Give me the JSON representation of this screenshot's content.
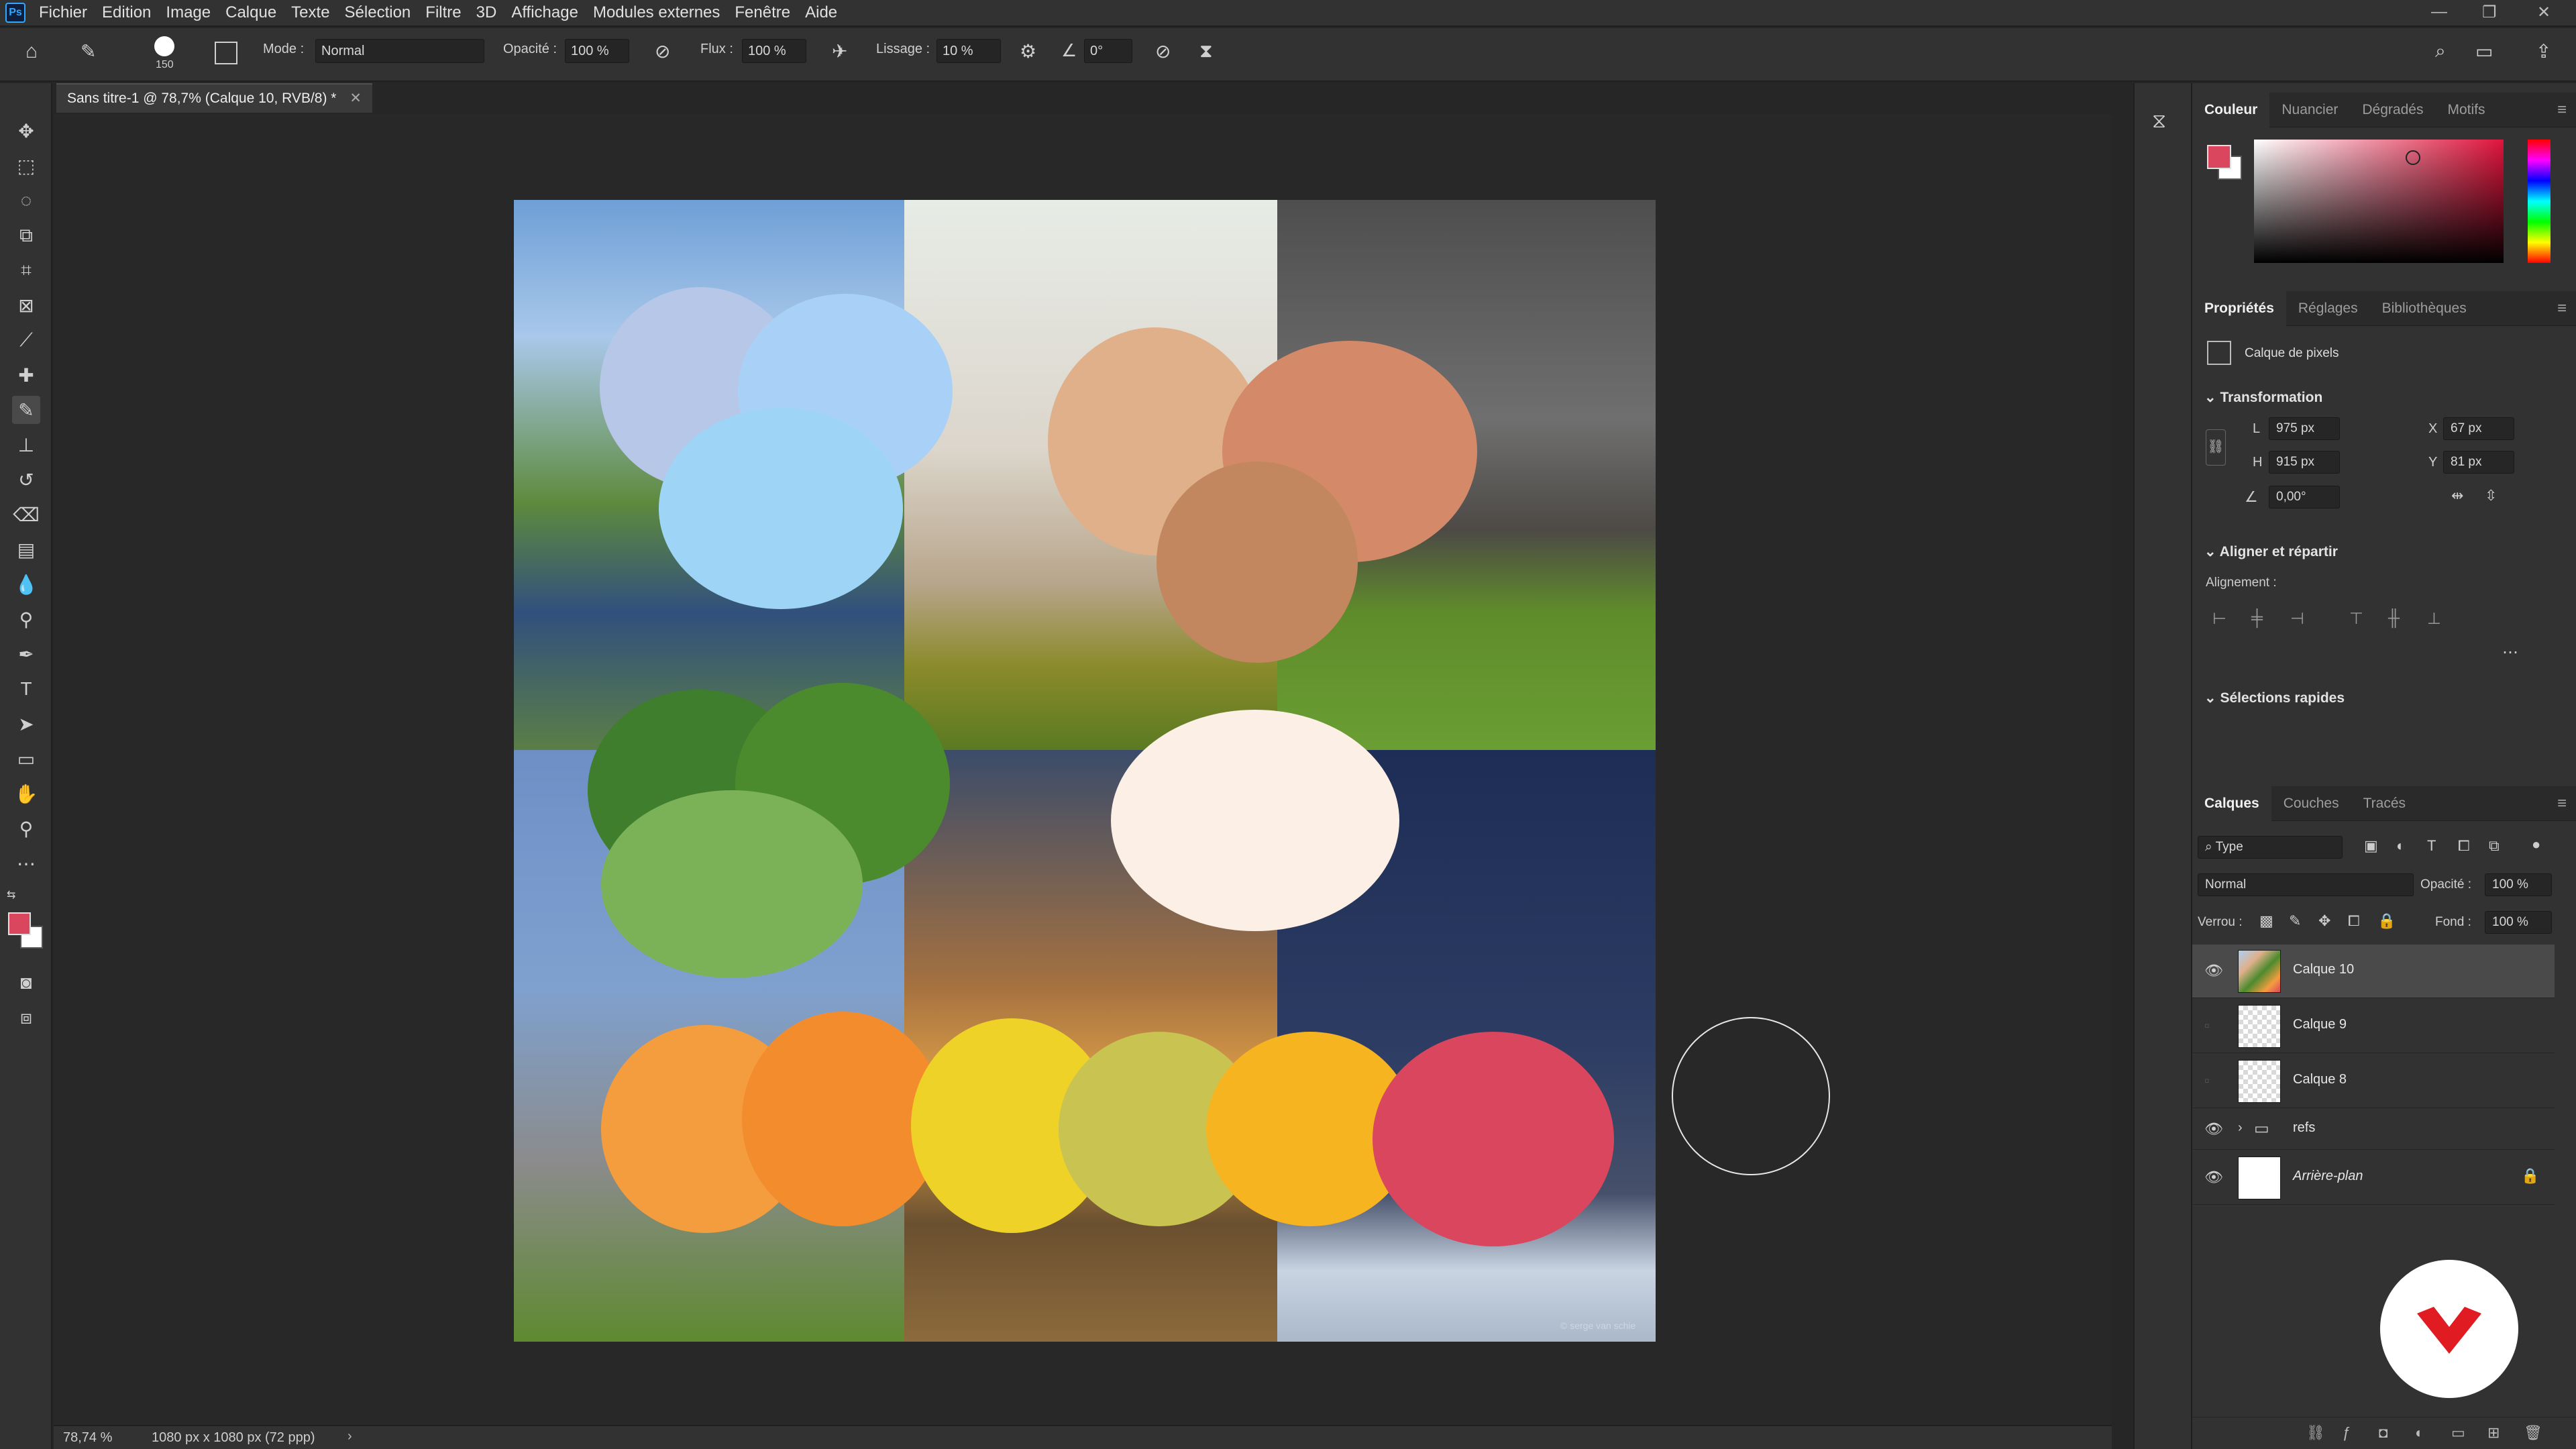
{
  "app": {
    "logo_text": "Ps"
  },
  "menu": [
    "Fichier",
    "Edition",
    "Image",
    "Calque",
    "Texte",
    "Sélection",
    "Filtre",
    "3D",
    "Affichage",
    "Modules externes",
    "Fenêtre",
    "Aide"
  ],
  "options_bar": {
    "brush_size": "150",
    "mode_label": "Mode :",
    "mode_value": "Normal",
    "opacity_label": "Opacité :",
    "opacity_value": "100 %",
    "flow_label": "Flux :",
    "flow_value": "100 %",
    "smoothing_label": "Lissage :",
    "smoothing_value": "10 %",
    "angle_value": "0°"
  },
  "document": {
    "tab_title": "Sans titre-1 @ 78,7% (Calque 10, RVB/8) *"
  },
  "status": {
    "zoom": "78,74 %",
    "doc_info": "1080 px x 1080 px (72 ppp)"
  },
  "color_panel": {
    "tabs": [
      "Couleur",
      "Nuancier",
      "Dégradés",
      "Motifs"
    ],
    "foreground": "#d9465e",
    "background": "#ffffff"
  },
  "properties_panel": {
    "tabs": [
      "Propriétés",
      "Réglages",
      "Bibliothèques"
    ],
    "kind": "Calque de pixels",
    "transform_title": "Transformation",
    "w_label": "L",
    "w_value": "975 px",
    "h_label": "H",
    "h_value": "915 px",
    "x_label": "X",
    "x_value": "67 px",
    "y_label": "Y",
    "y_value": "81 px",
    "angle": "0,00°",
    "align_title": "Aligner et répartir",
    "align_label": "Alignement :",
    "quick_title": "Sélections rapides"
  },
  "layers_panel": {
    "tabs": [
      "Calques",
      "Couches",
      "Tracés"
    ],
    "filter": "Type",
    "blend": "Normal",
    "opacity_label": "Opacité :",
    "opacity_value": "100 %",
    "lock_label": "Verrou :",
    "fill_label": "Fond :",
    "fill_value": "100 %",
    "layers": [
      {
        "name": "Calque 10",
        "visible": true,
        "active": true
      },
      {
        "name": "Calque 9",
        "visible": false,
        "active": false
      },
      {
        "name": "Calque 8",
        "visible": false,
        "active": false
      },
      {
        "name": "refs",
        "visible": true,
        "active": false
      },
      {
        "name": "Arrière-plan",
        "visible": true,
        "active": false
      }
    ]
  },
  "palette_colors": {
    "sky": [
      "#b6c7e8",
      "#a9d1f7",
      "#9ed4f6"
    ],
    "skin": [
      "#e0b08a",
      "#d48a68",
      "#c2875f"
    ],
    "green": [
      "#3f7e2c",
      "#4b8b2e",
      "#7bb257"
    ],
    "cream": "#fcefe5",
    "warm": [
      "#f49d3f",
      "#f38c2d",
      "#efd227",
      "#c9c352",
      "#f7b421",
      "#d9465e"
    ]
  },
  "watermark_text": "© serge van schie"
}
